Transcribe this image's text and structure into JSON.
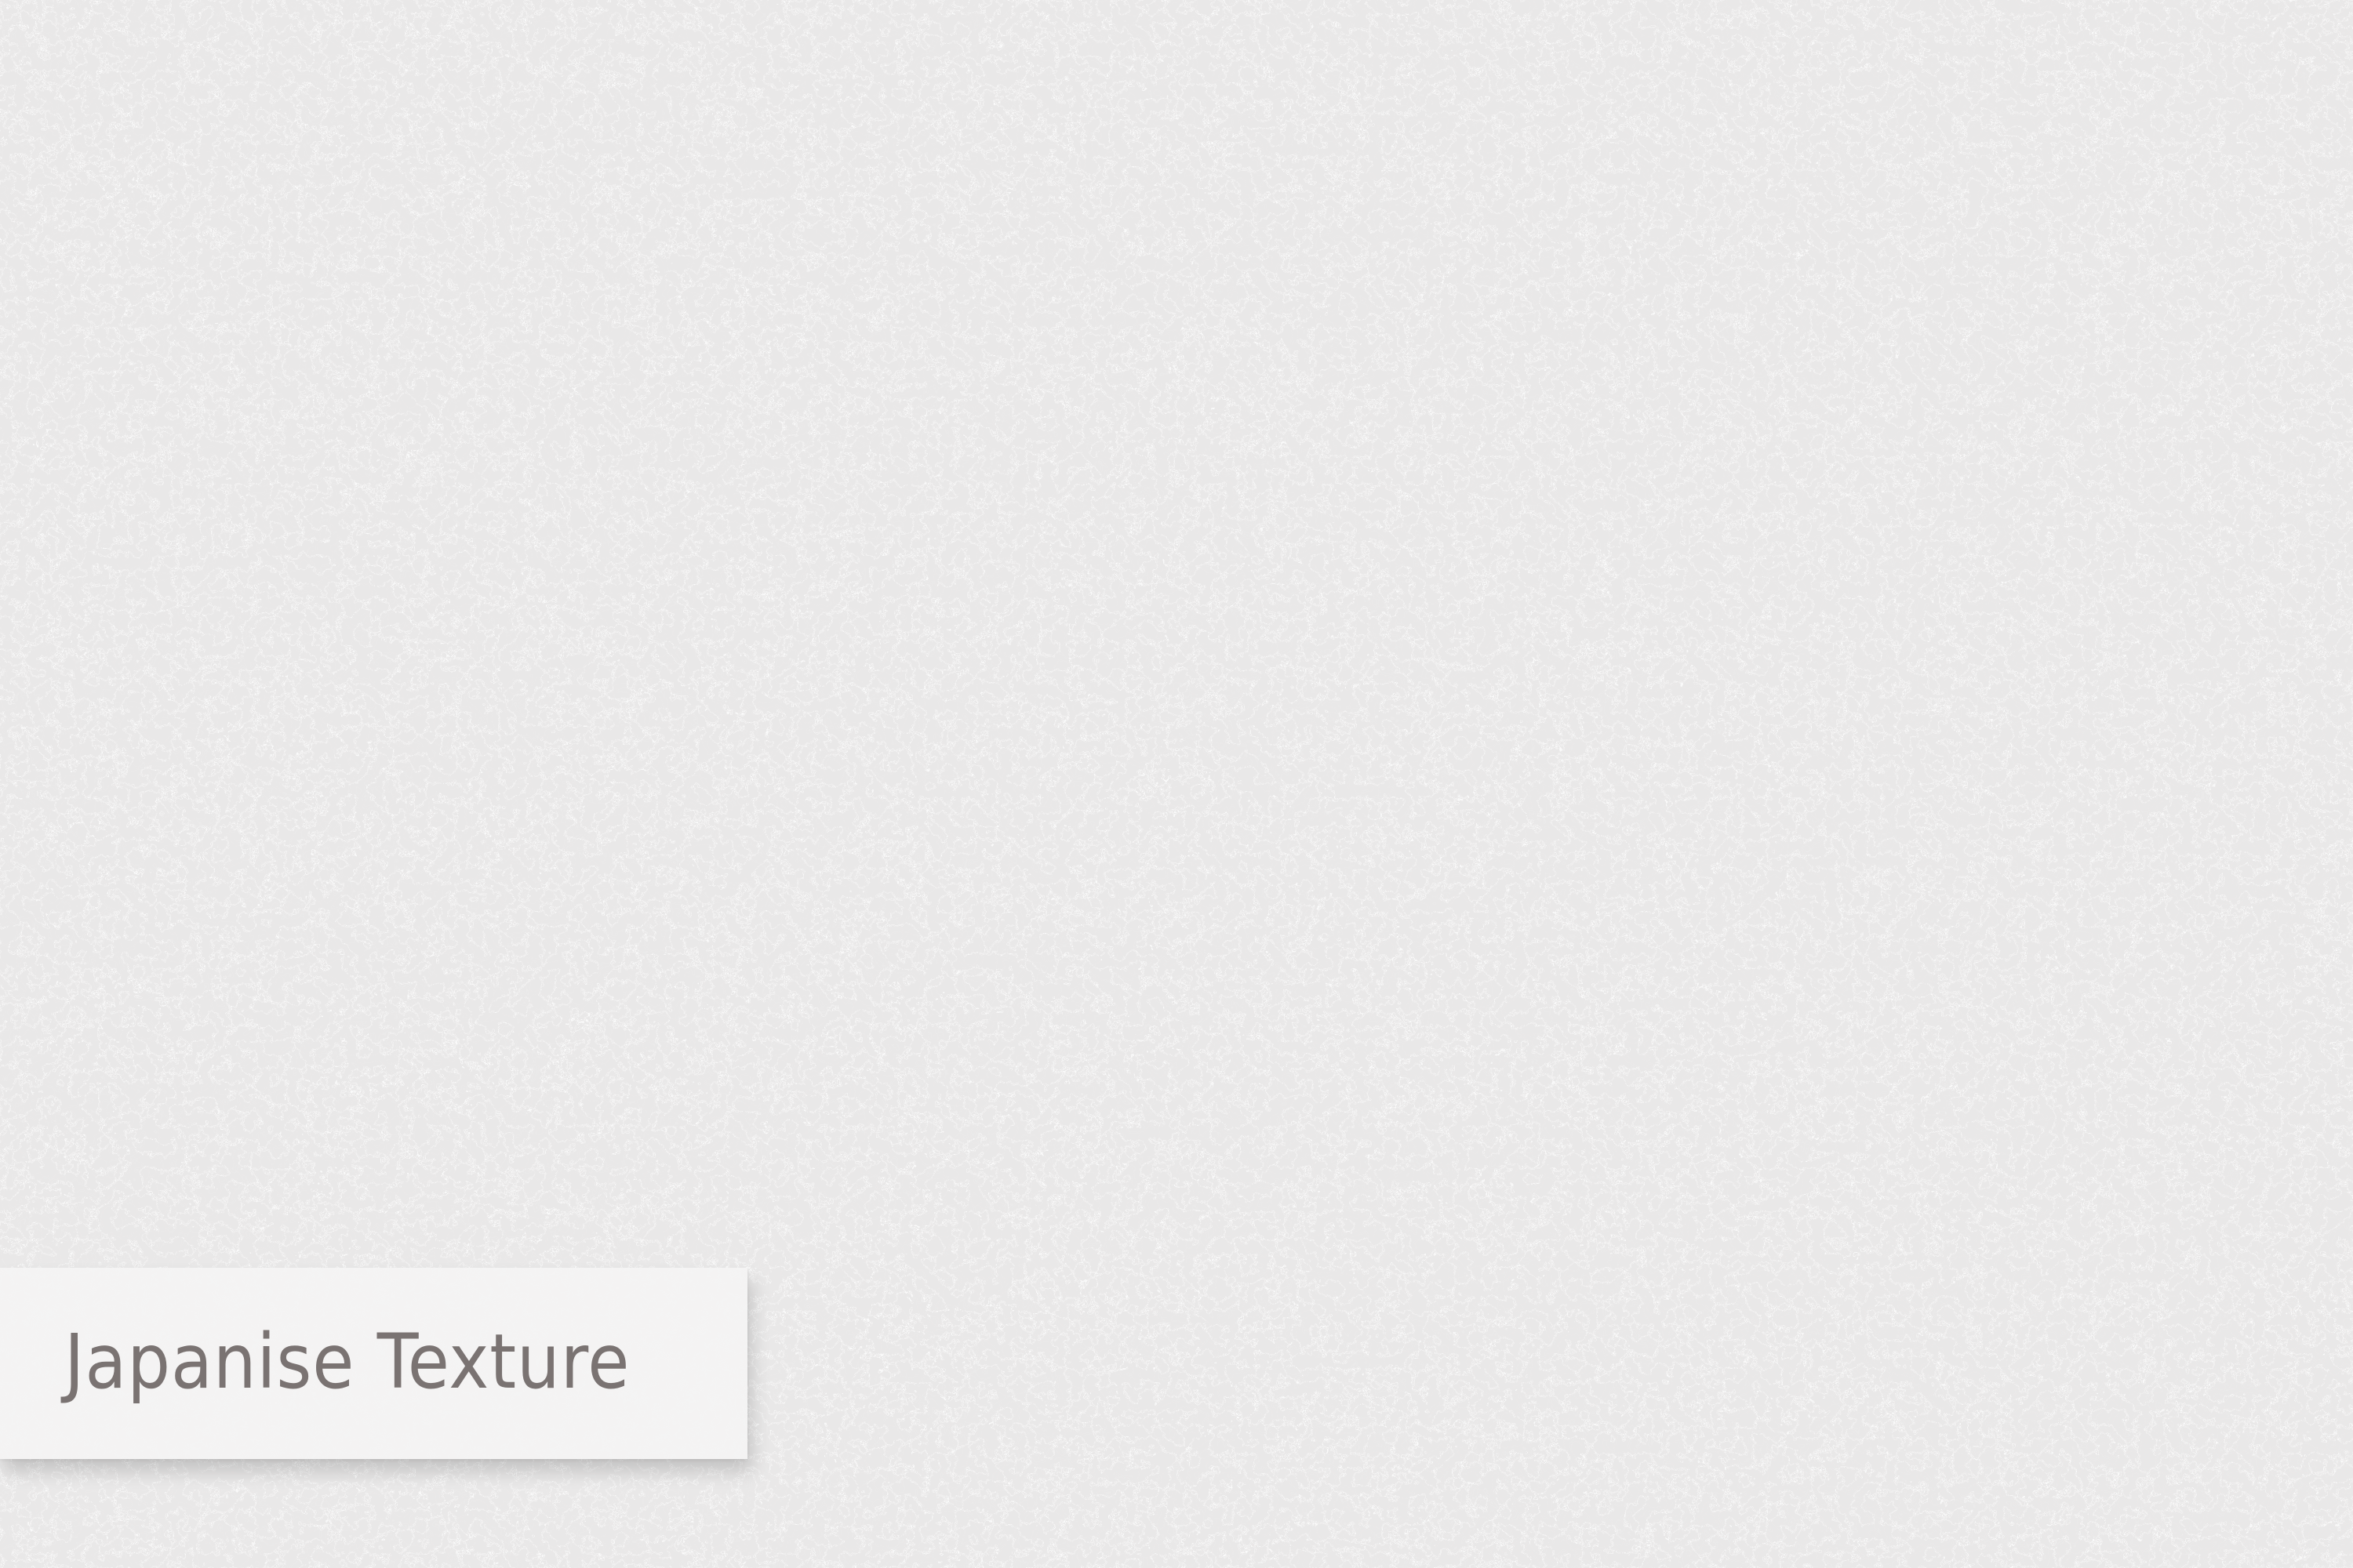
{
  "background": {
    "pattern": "organic-maze-texture",
    "base_color": "#e9e8e8",
    "line_color": "#f6f5f5"
  },
  "label": {
    "text": "Japanise Texture",
    "text_color": "#7a7372",
    "card_color": "#f4f3f3"
  }
}
